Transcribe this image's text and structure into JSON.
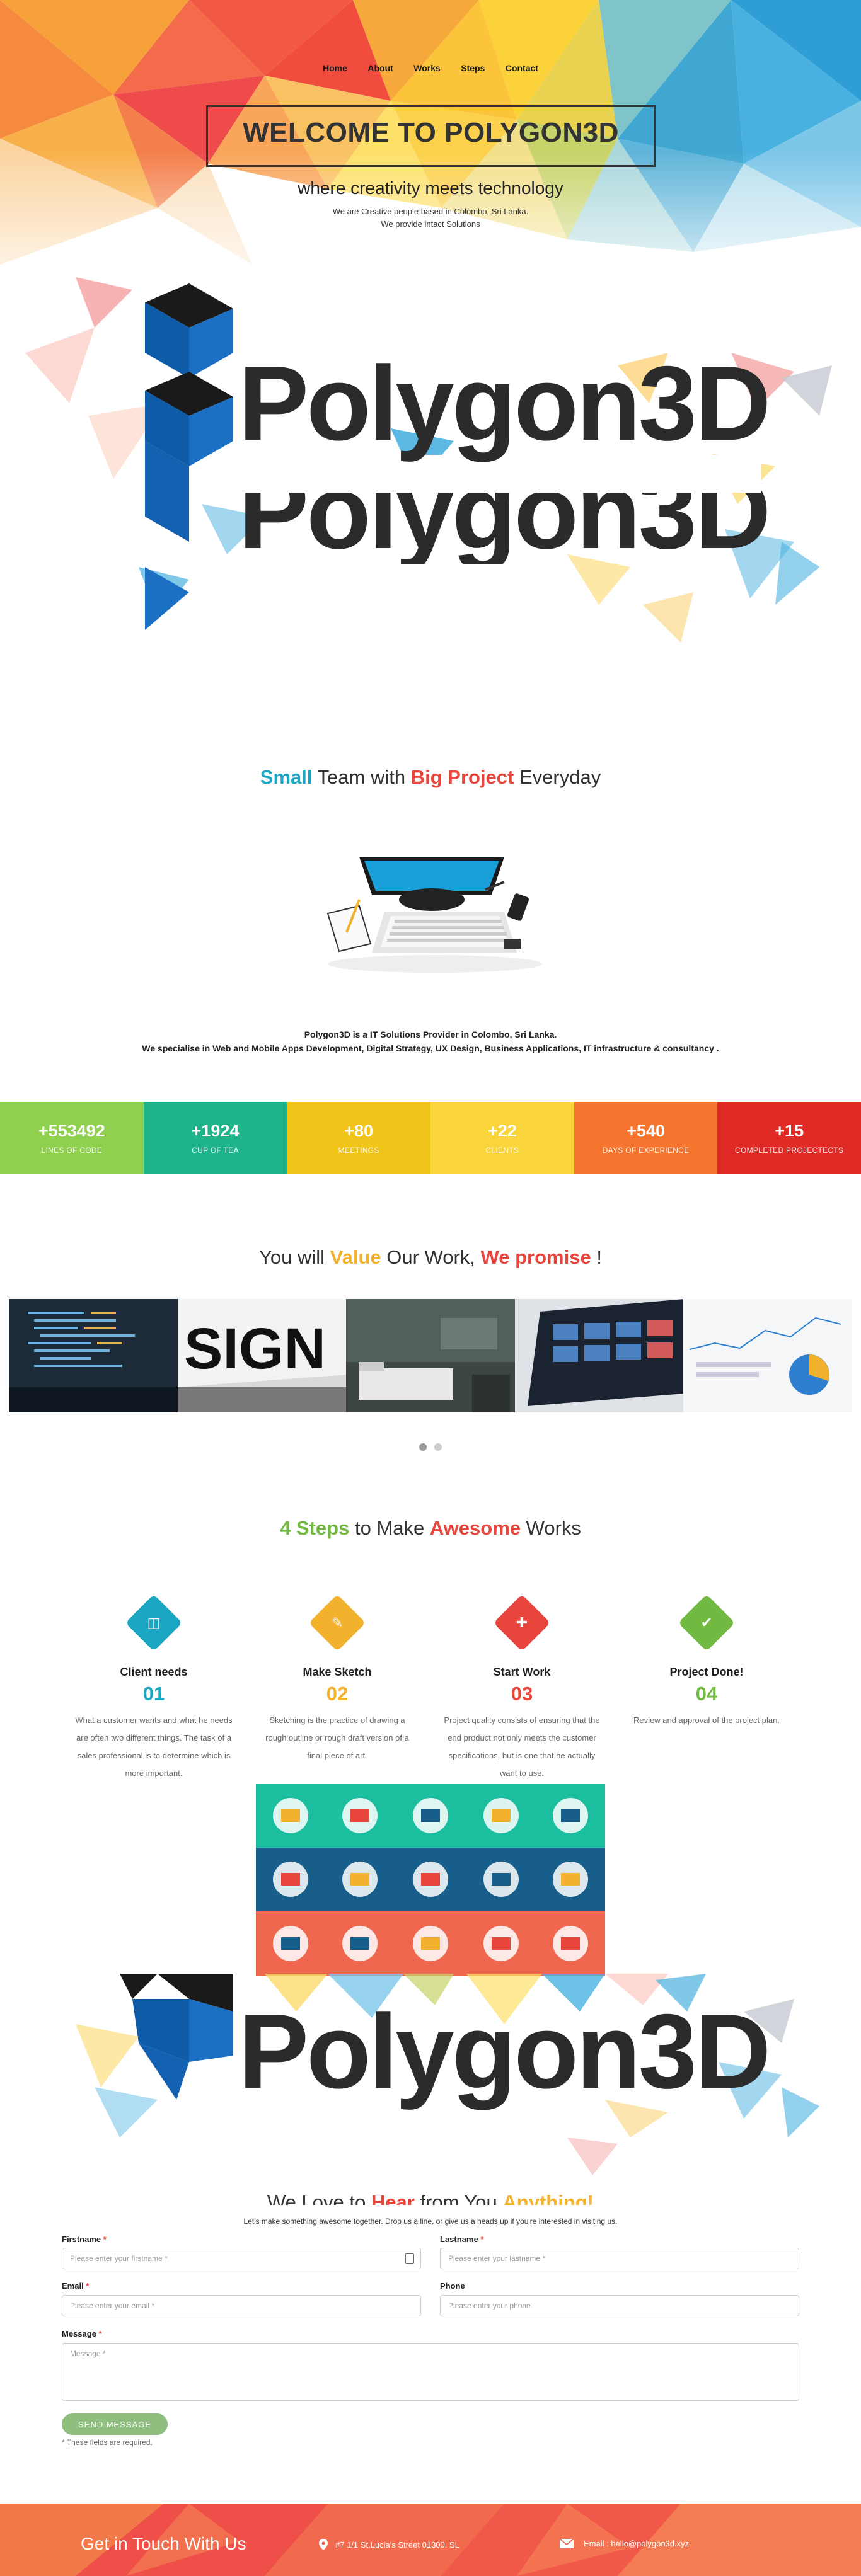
{
  "nav": {
    "home": "Home",
    "about": "About",
    "works": "Works",
    "steps": "Steps",
    "contact": "Contact"
  },
  "hero": {
    "title": "WELCOME TO POLYGON3D",
    "subtitle": "where creativity meets technology",
    "desc_line1": "We are Creative people based in Colombo, Sri Lanka.",
    "desc_line2": "We provide intact Solutions",
    "logo": "Polygon3D"
  },
  "about": {
    "title_a": "Small",
    "title_b": " Team with ",
    "title_c": "Big Project",
    "title_d": " Everyday",
    "line1": "Polygon3D is a IT Solutions Provider in Colombo, Sri Lanka.",
    "line2": "We specialise in Web and Mobile Apps Development, Digital Strategy, UX Design, Business Applications, IT infrastructure & consultancy ."
  },
  "stats": [
    {
      "num": "+553492",
      "label": "LINES OF CODE",
      "color": "#8fd14f"
    },
    {
      "num": "+1924",
      "label": "CUP OF TEA",
      "color": "#1fb38a"
    },
    {
      "num": "+80",
      "label": "MEETINGS",
      "color": "#f0c419"
    },
    {
      "num": "+22",
      "label": "CLIENTS",
      "color": "#f9d43a"
    },
    {
      "num": "+540",
      "label": "DAYS OF EXPERIENCE",
      "color": "#f5752e"
    },
    {
      "num": "+15",
      "label": "COMPLETED PROJECTECTS",
      "color": "#e02a26"
    }
  ],
  "value": {
    "a": "You will ",
    "b": "Value",
    "c": " Our Work, ",
    "d": "We promise",
    "e": " !"
  },
  "steps_title": {
    "a": "4 Steps",
    "b": " to Make ",
    "c": "Awesome",
    "d": " Works"
  },
  "steps": [
    {
      "title": "Client needs",
      "num": "01",
      "desc": "What a customer wants and what he needs are often two different things. The task of a sales professional is to determine which is more important.",
      "color": "#1ba6c4",
      "icon": "briefcase-icon"
    },
    {
      "title": "Make Sketch",
      "num": "02",
      "desc": "Sketching is the practice of drawing a rough outline or rough draft version of a final piece of art.",
      "color": "#f2b22e",
      "icon": "sketch-icon"
    },
    {
      "title": "Start Work",
      "num": "03",
      "desc": "Project quality consists of ensuring that the end product not only meets the customer specifications, but is one that he actually want to use.",
      "color": "#e8453c",
      "icon": "crop-icon"
    },
    {
      "title": "Project Done!",
      "num": "04",
      "desc": "Review and approval of the project plan.",
      "color": "#72b941",
      "icon": "check-icon"
    }
  ],
  "contact": {
    "heading_a": "We Love to ",
    "heading_b": "Hear",
    "heading_c": " from You ",
    "heading_d": "Anything!",
    "intro": "Let's make something awesome together. Drop us a line, or give us a heads up if you're interested in visiting us.",
    "firstname_label": "Firstname",
    "firstname_ph": "Please enter your firstname *",
    "lastname_label": "Lastname",
    "lastname_ph": "Please enter your lastname *",
    "email_label": "Email",
    "email_ph": "Please enter your email *",
    "phone_label": "Phone",
    "phone_ph": "Please enter your phone",
    "message_label": "Message",
    "message_ph": "Message *",
    "send": "SEND MESSAGE",
    "note": "* These fields are required."
  },
  "footer": {
    "title": "Get in Touch With Us",
    "address": "#7 1/1 St.Lucia's Street 01300. SL",
    "email": "Email : hello@polygon3d.xyz"
  }
}
